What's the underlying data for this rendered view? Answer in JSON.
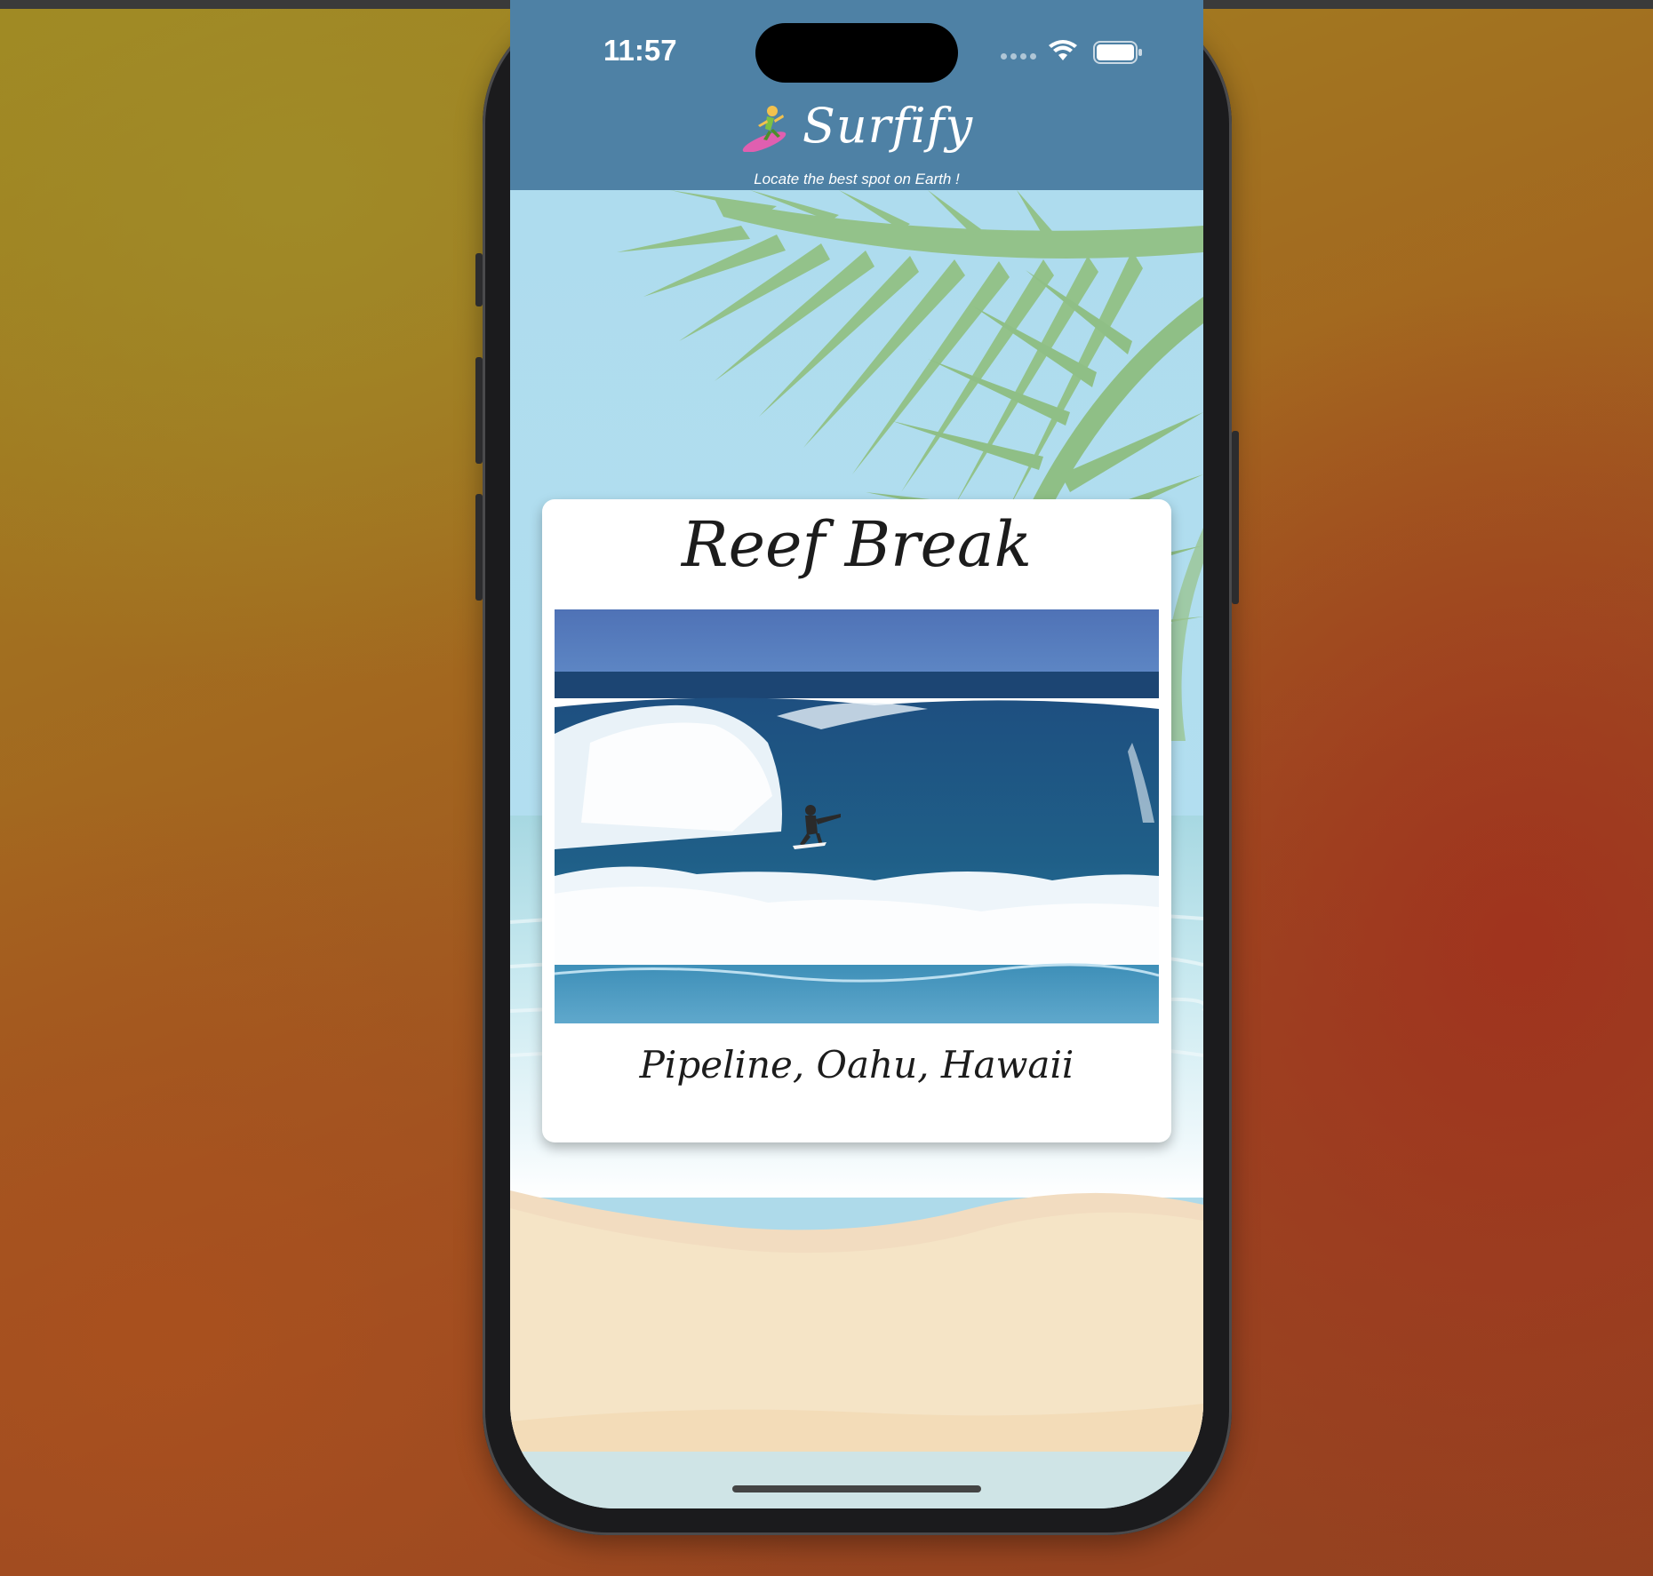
{
  "status_bar": {
    "time": "11:57"
  },
  "app": {
    "name": "Surfify",
    "tagline": "Locate the best spot on Earth !"
  },
  "card": {
    "title": "Reef Break",
    "location": "Pipeline, Oahu, Hawaii",
    "image_icon": "surf-photo"
  },
  "colors": {
    "header": "#4e81a5",
    "sky": "#aedcee",
    "sand": "#f5e4c6",
    "palm": "#93c28a",
    "card": "#ffffff"
  }
}
